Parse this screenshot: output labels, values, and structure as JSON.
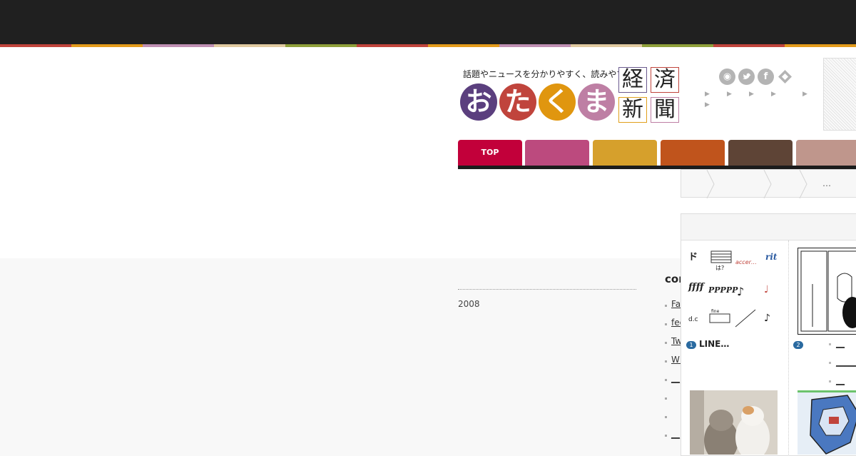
{
  "header": {
    "tagline": "話題やニュースを分かりやすく、読みやすく。",
    "logo_chars": [
      "お",
      "た",
      "く",
      "ま"
    ],
    "logo_colors": [
      "#5b3f7e",
      "#c0443c",
      "#e0960f",
      "#be7fa4"
    ],
    "logo_kanji": [
      "経",
      "済",
      "新",
      "聞"
    ],
    "stripe_colors": [
      "#c0443c",
      "#e39b1b",
      "#bf8fb3",
      "#e0c9a0",
      "#8fa03a",
      "#c0443c",
      "#e39b1b",
      "#bf8fb3",
      "#e0c9a0",
      "#8fa03a",
      "#c0443c",
      "#e39b1b"
    ]
  },
  "social_icons": [
    {
      "name": "rss",
      "glyph": "◉"
    },
    {
      "name": "twitter",
      "glyph": "🐦"
    },
    {
      "name": "facebook",
      "glyph": "f"
    },
    {
      "name": "feedly",
      "glyph": "✓"
    }
  ],
  "nav": {
    "tabs": [
      {
        "label": "TOP",
        "color": "#c2003a"
      },
      {
        "label": "",
        "color": "#bc4a7e"
      },
      {
        "label": "",
        "color": "#d6a02c"
      },
      {
        "label": "",
        "color": "#c0541c"
      },
      {
        "label": "",
        "color": "#5e4436"
      },
      {
        "label": "",
        "color": "#bf968c"
      }
    ],
    "bar_color": "#1c1c1c"
  },
  "breadcrumb": {
    "ellipsis": "…"
  },
  "ranking": {
    "items": [
      {
        "rank": "1",
        "title": "LINE…"
      },
      {
        "rank": "2",
        "title": ""
      }
    ],
    "manga_terms": [
      "rit",
      "accer…",
      "ffff",
      "PPPPP",
      "fine"
    ]
  },
  "archive": {
    "year": "2008"
  },
  "contents": {
    "title": "cont",
    "links": [
      "Face",
      "feed",
      "Twitter",
      "WEB__",
      "__",
      "",
      "",
      "__"
    ]
  },
  "sub_items": [
    "__",
    "_____",
    "__"
  ]
}
